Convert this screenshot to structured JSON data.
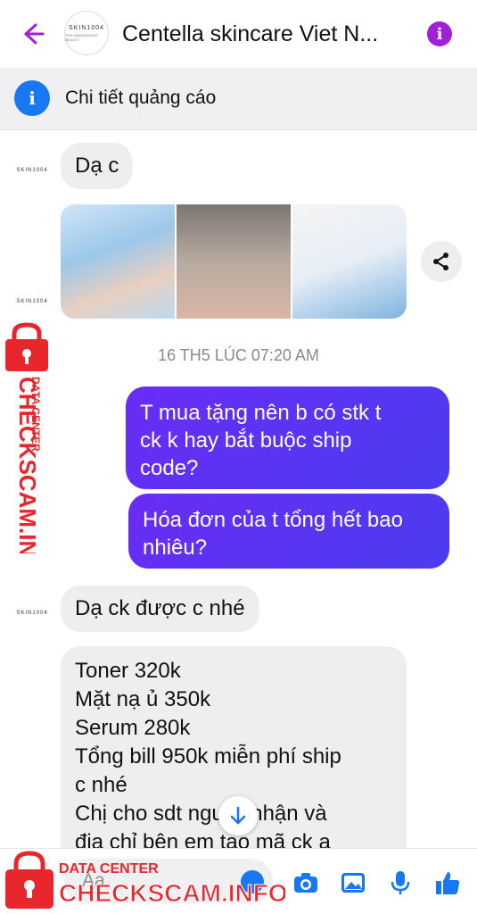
{
  "header": {
    "title": "Centella skincare Viet N...",
    "avatar_brand": "SKIN1004",
    "avatar_sub": "THE HARMONIOUS BEAUTY"
  },
  "ad_bar": {
    "label": "Chi tiết quảng cáo"
  },
  "messages": {
    "m1": "Dạ c",
    "timestamp": "16 TH5 LÚC 07:20 AM",
    "out1": [
      "T mua tặng nên b có stk t",
      "ck k hay bắt buộc ship",
      "code?"
    ],
    "out2": [
      "Hóa đơn của t tổng hết bao",
      "nhiêu?"
    ],
    "m2": "Dạ ck được c nhé",
    "m3": [
      "Toner 320k",
      "Mặt nạ ủ 350k",
      "Serum 280k",
      "Tổng bill 950k miễn phí ship",
      "c nhé",
      "Chị cho sdt người nhận và",
      "địa chỉ bên em tạo mã ck a"
    ]
  },
  "composer": {
    "placeholder": "Aa"
  },
  "watermark": {
    "label": "DATA CENTER",
    "brand": "CHECKSCAM.INFO"
  },
  "colors": {
    "accent_purple": "#a020d8",
    "outgoing_start": "#6a2cf5",
    "outgoing_end": "#4a3cf0",
    "facebook_blue": "#1877f2",
    "watermark_red": "#e8262b"
  },
  "icons": {
    "back": "back-arrow-icon",
    "info": "info-icon",
    "share": "share-icon",
    "scroll": "arrow-down-icon",
    "camera": "camera-icon",
    "photo": "photo-icon",
    "mic": "microphone-icon",
    "like": "thumbs-up-icon",
    "lock": "padlock-icon"
  }
}
